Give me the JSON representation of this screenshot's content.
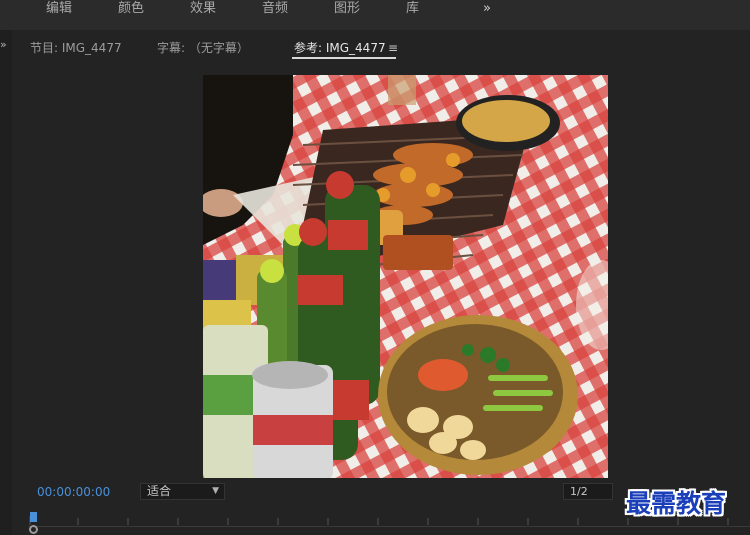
{
  "workspace_menu": {
    "items": [
      "编辑",
      "颜色",
      "效果",
      "音频",
      "图形",
      "库"
    ],
    "more": "»"
  },
  "panel": {
    "tabs": [
      {
        "label": "节目: IMG_4477"
      },
      {
        "label": "字幕: （无字幕）"
      },
      {
        "label": "参考: IMG_4477",
        "active": true
      }
    ],
    "tab_menu_icon": "≡",
    "left_expand": "»"
  },
  "monitor": {
    "timecode": "00:00:00:00",
    "fit": "适合",
    "resolution": "1/2"
  },
  "watermark": {
    "text": "最需教育"
  },
  "colors": {
    "accent": "#4a90d9",
    "panel_bg": "#232323",
    "watermark": "#1a3fb8"
  }
}
